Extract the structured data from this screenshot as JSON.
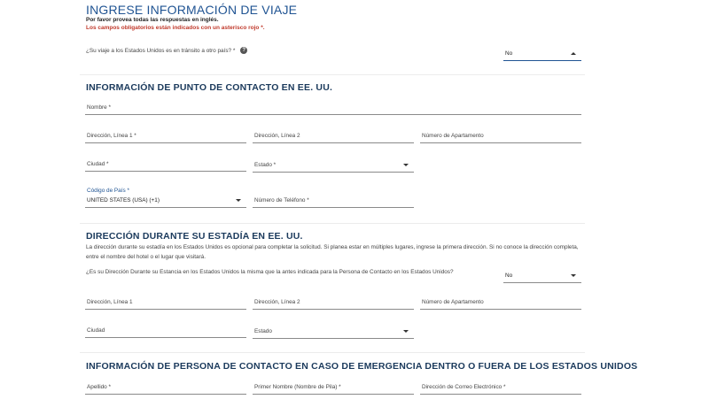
{
  "header": {
    "title": "INGRESE INFORMACIÓN DE VIAJE",
    "note": "Por favor provea todas las respuestas en inglés.",
    "required_note": "Los campos obligatorios están indicados con un asterisco rojo *."
  },
  "transit": {
    "question": "¿Su viaje a los Estados Unidos es en tránsito a otro país? *",
    "help_icon": "question-circle-icon",
    "value": "No"
  },
  "contact_section": {
    "title": "INFORMACIÓN DE PUNTO DE CONTACTO EN EE. UU.",
    "name_label": "Nombre *",
    "address1_label": "Dirección, Línea 1 *",
    "address2_label": "Dirección, Línea 2",
    "apt_label": "Número de Apartamento",
    "city_label": "Ciudad *",
    "state_label": "Estado *",
    "country_code_label": "Código de País *",
    "country_code_value": "UNITED STATES (USA) (+1)",
    "phone_label": "Número de Teléfono *"
  },
  "stay_section": {
    "title": "DIRECCIÓN DURANTE SU ESTADÍA EN EE. UU.",
    "description_line1": "La dirección durante su estadía en los Estados Unidos es opcional para completar la solicitud. Si planea estar en múltiples lugares, ingrese la primera dirección. Si no conoce la dirección completa,",
    "description_line2": "entre el nombre del hotel o el lugar que visitará.",
    "same_question": "¿Es su Dirección Durante su Estancia en los Estados Unidos la misma que la antes indicada para la Persona de Contacto en los Estados Unidos?",
    "same_value": "No",
    "address1_label": "Dirección, Línea 1",
    "address2_label": "Dirección, Línea 2",
    "apt_label": "Número de Apartamento",
    "city_label": "Ciudad",
    "state_label": "Estado"
  },
  "emergency_section": {
    "title": "INFORMACIÓN DE PERSONA DE CONTACTO EN CASO DE EMERGENCIA DENTRO O FUERA DE LOS ESTADOS UNIDOS",
    "surname_label": "Apellido *",
    "first_name_label": "Primer Nombre (Nombre de Pila) *",
    "email_label": "Dirección de Correo Electrónico *"
  },
  "colors": {
    "heading_blue": "#205493",
    "required_red": "#c0392b"
  }
}
